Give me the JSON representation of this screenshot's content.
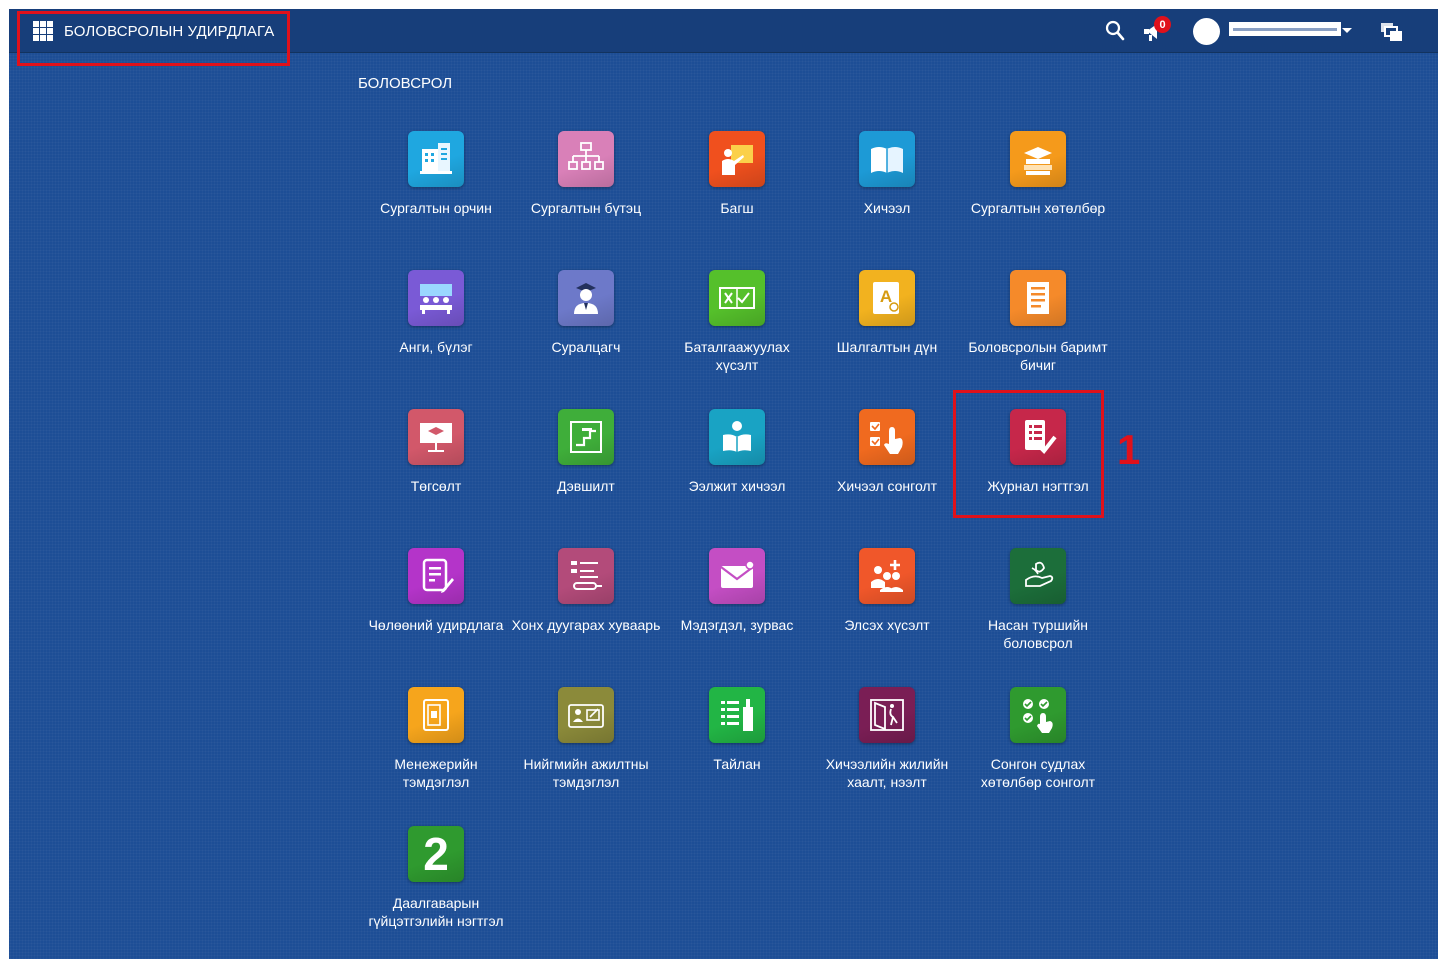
{
  "header": {
    "app_title": "БОЛОВСРОЛЫН УДИРДЛАГА",
    "notification_count": "0",
    "user_name": ""
  },
  "section": {
    "title": "БОЛОВСРОЛ"
  },
  "annotation": {
    "step_number": "1"
  },
  "tiles": [
    {
      "label": "Сургалтын орчин",
      "icon": "building-icon",
      "color": "#1fa7e0"
    },
    {
      "label": "Сургалтын бүтэц",
      "icon": "org-chart-icon",
      "color": "#d980b8"
    },
    {
      "label": "Багш",
      "icon": "teacher-icon",
      "color": "#f0501e"
    },
    {
      "label": "Хичээл",
      "icon": "book-icon",
      "color": "#1d9ad6"
    },
    {
      "label": "Сургалтын хөтөлбөр",
      "icon": "book-stack-icon",
      "color": "#f59a1b"
    },
    {
      "label": "Анги, бүлэг",
      "icon": "classroom-icon",
      "color": "#7a5ad6"
    },
    {
      "label": "Суралцагч",
      "icon": "student-icon",
      "color": "#6d79c9"
    },
    {
      "label": "Баталгаажуулах хүсэлт",
      "icon": "approval-icon",
      "color": "#55c02b"
    },
    {
      "label": "Шалгалтын дүн",
      "icon": "exam-grade-icon",
      "color": "#f2b21f"
    },
    {
      "label": "Боловсролын баримт бичиг",
      "icon": "document-icon",
      "color": "#f58a2a"
    },
    {
      "label": "Төгсөлт",
      "icon": "graduation-icon",
      "color": "#d2586a"
    },
    {
      "label": "Дэвшилт",
      "icon": "promotion-icon",
      "color": "#3fae3a"
    },
    {
      "label": "Ээлжит хичээл",
      "icon": "reader-icon",
      "color": "#19a3c4"
    },
    {
      "label": "Хичээл сонголт",
      "icon": "course-selection-icon",
      "color": "#f06a1f"
    },
    {
      "label": "Журнал нэгтгэл",
      "icon": "journal-check-icon",
      "color": "#c6274a"
    },
    {
      "label": "Чөлөөний удирдлага",
      "icon": "leave-form-icon",
      "color": "#b434c9"
    },
    {
      "label": "Хонх дуугарах хуваарь",
      "icon": "bell-schedule-icon",
      "color": "#b34b7a"
    },
    {
      "label": "Мэдэгдэл, зурвас",
      "icon": "envelope-icon",
      "color": "#c44ec4"
    },
    {
      "label": "Элсэх хүсэлт",
      "icon": "enrollment-icon",
      "color": "#f0572a"
    },
    {
      "label": "Насан туршийн боловсрол",
      "icon": "lifelong-learning-icon",
      "color": "#1c6e3a"
    },
    {
      "label": "Менежерийн тэмдэглэл",
      "icon": "manager-note-icon",
      "color": "#f6a51c"
    },
    {
      "label": "Нийгмийн ажилтны тэмдэглэл",
      "icon": "social-worker-icon",
      "color": "#8b8a3a"
    },
    {
      "label": "Тайлан",
      "icon": "report-icon",
      "color": "#22b545"
    },
    {
      "label": "Хичээлийн жилийн хаалт, нээлт",
      "icon": "door-icon",
      "color": "#7a1e55"
    },
    {
      "label": "Сонгон судлах хөтөлбөр сонголт",
      "icon": "elective-check-icon",
      "color": "#2f9a2f"
    },
    {
      "label": "Даалгаварын гүйцэтгэлийн нэгтгэл",
      "icon": "number-two-icon",
      "color": "#2f9a2f",
      "glyph": "2"
    }
  ]
}
